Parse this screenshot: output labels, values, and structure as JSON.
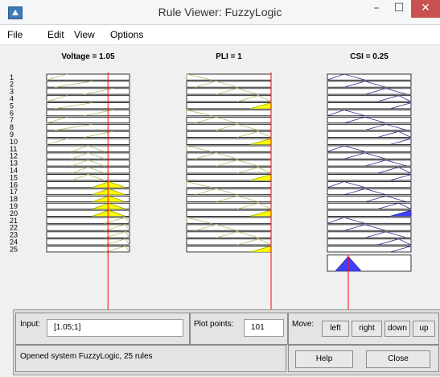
{
  "window": {
    "title": "Rule Viewer: FuzzyLogic",
    "min": "–",
    "max": "☐",
    "close": "✕"
  },
  "menu": [
    "File",
    "Edit",
    "View",
    "Options"
  ],
  "variables": [
    {
      "title": "Voltage = 1.05",
      "input_line": 1.05
    },
    {
      "title": "PLI = 1",
      "input_line": 1
    },
    {
      "title": "CSI = 0.25"
    }
  ],
  "rule_count": 25,
  "rule_labels": [
    "1",
    "2",
    "3",
    "4",
    "5",
    "6",
    "7",
    "8",
    "9",
    "10",
    "11",
    "12",
    "13",
    "14",
    "15",
    "16",
    "17",
    "18",
    "19",
    "20",
    "21",
    "22",
    "23",
    "24",
    "25"
  ],
  "controls": {
    "input_label": "Input:",
    "input_value": "[1.05;1]",
    "plot_points_label": "Plot points:",
    "plot_points_value": "101",
    "move_label": "Move:",
    "left": "left",
    "right": "right",
    "down": "down",
    "up": "up",
    "status": "Opened system FuzzyLogic, 25 rules",
    "help": "Help",
    "close": "Close"
  },
  "colors": {
    "input_mf": "#ffff00",
    "output_mf": "#4040ff",
    "line": "#ff0000"
  }
}
